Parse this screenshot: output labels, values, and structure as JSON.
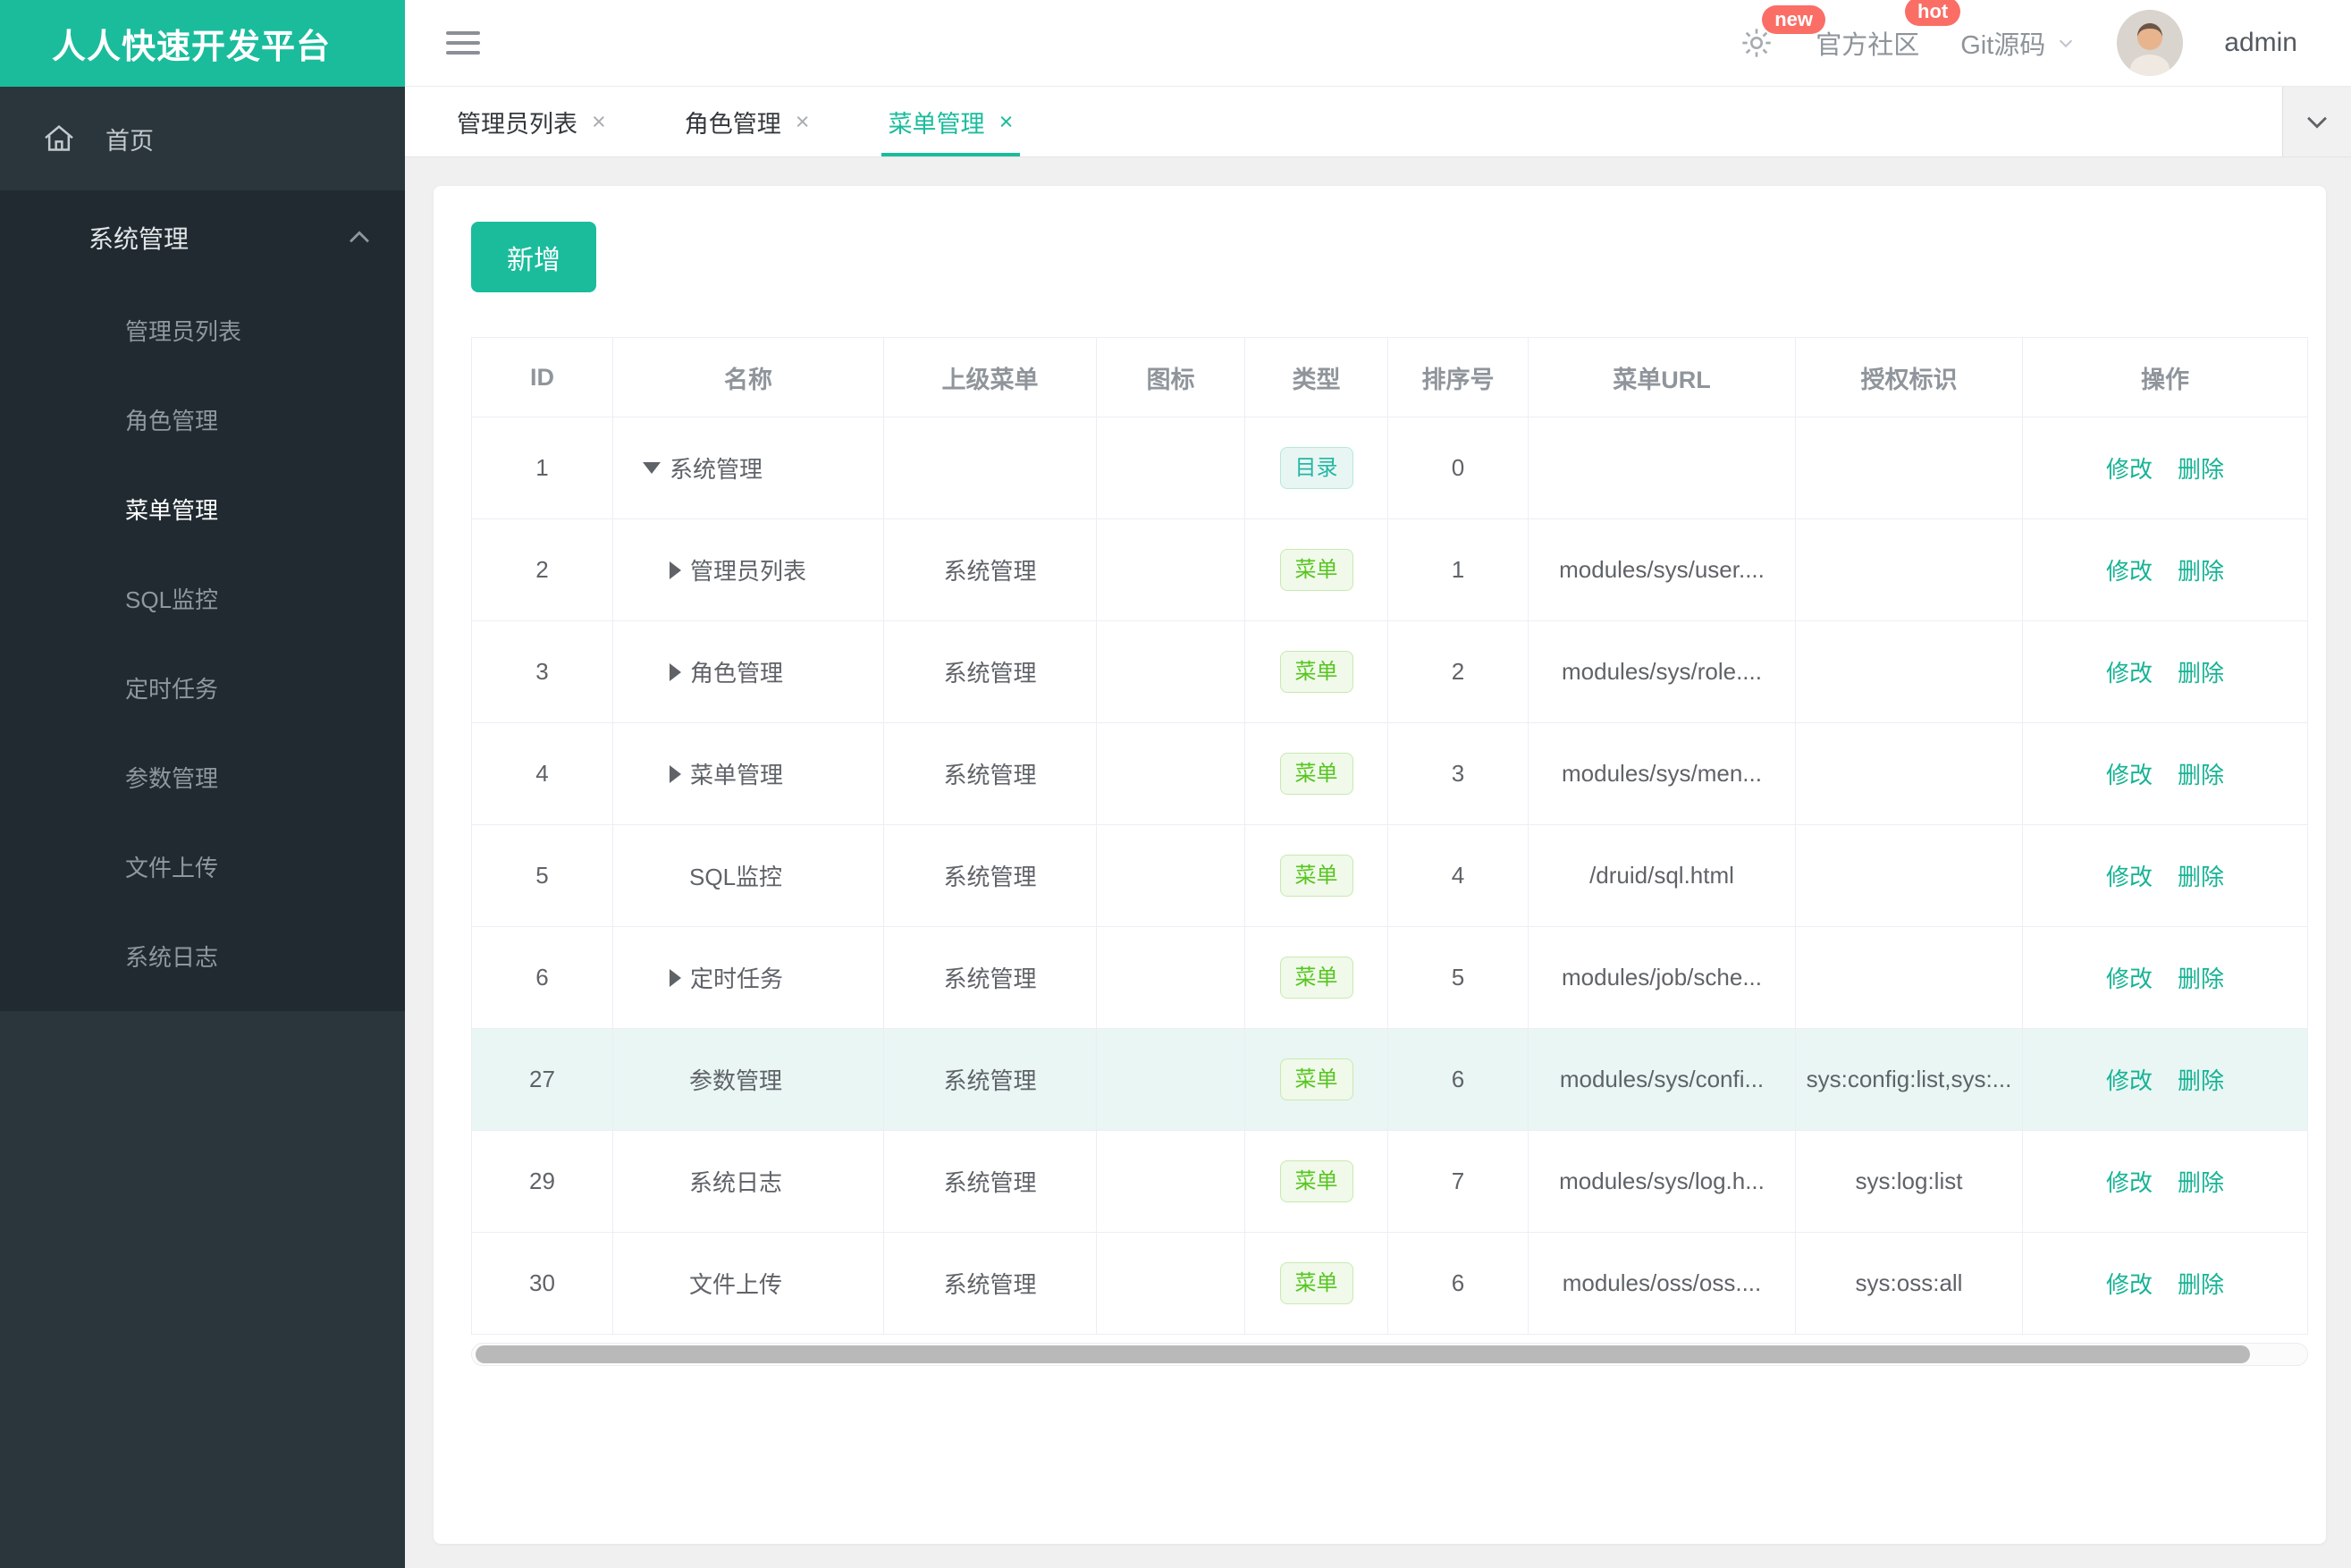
{
  "brand": {
    "title": "人人快速开发平台"
  },
  "header": {
    "gear_badge": "new",
    "community": {
      "label": "官方社区",
      "badge": "hot"
    },
    "git": {
      "label": "Git源码"
    },
    "username": "admin"
  },
  "sidebar": {
    "home": {
      "label": "首页"
    },
    "group": {
      "label": "系统管理",
      "items": [
        {
          "label": "管理员列表",
          "active": false
        },
        {
          "label": "角色管理",
          "active": false
        },
        {
          "label": "菜单管理",
          "active": true
        },
        {
          "label": "SQL监控",
          "active": false
        },
        {
          "label": "定时任务",
          "active": false
        },
        {
          "label": "参数管理",
          "active": false
        },
        {
          "label": "文件上传",
          "active": false
        },
        {
          "label": "系统日志",
          "active": false
        }
      ]
    }
  },
  "tabs": [
    {
      "label": "管理员列表",
      "active": false
    },
    {
      "label": "角色管理",
      "active": false
    },
    {
      "label": "菜单管理",
      "active": true
    }
  ],
  "toolbar": {
    "add_label": "新增"
  },
  "table": {
    "columns": [
      "ID",
      "名称",
      "上级菜单",
      "图标",
      "类型",
      "排序号",
      "菜单URL",
      "授权标识",
      "操作"
    ],
    "actions": {
      "edit": "修改",
      "delete": "删除"
    },
    "type_styles": {
      "目录": {
        "color": "#23b7a4",
        "bg": "#e8f6f3",
        "border": "#b7e6de"
      },
      "菜单": {
        "color": "#57c520",
        "bg": "#f0f9ea",
        "border": "#c9e9b0"
      }
    },
    "rows": [
      {
        "id": "1",
        "name": "系统管理",
        "arrow": "down",
        "indent": 0,
        "parent": "",
        "type": "目录",
        "sort": "0",
        "url": "",
        "perm": "",
        "highlighted": false
      },
      {
        "id": "2",
        "name": "管理员列表",
        "arrow": "right",
        "indent": 1,
        "parent": "系统管理",
        "type": "菜单",
        "sort": "1",
        "url": "modules/sys/user....",
        "perm": "",
        "highlighted": false
      },
      {
        "id": "3",
        "name": "角色管理",
        "arrow": "right",
        "indent": 1,
        "parent": "系统管理",
        "type": "菜单",
        "sort": "2",
        "url": "modules/sys/role....",
        "perm": "",
        "highlighted": false
      },
      {
        "id": "4",
        "name": "菜单管理",
        "arrow": "right",
        "indent": 1,
        "parent": "系统管理",
        "type": "菜单",
        "sort": "3",
        "url": "modules/sys/men...",
        "perm": "",
        "highlighted": false
      },
      {
        "id": "5",
        "name": "SQL监控",
        "arrow": null,
        "indent": 1,
        "parent": "系统管理",
        "type": "菜单",
        "sort": "4",
        "url": "/druid/sql.html",
        "perm": "",
        "highlighted": false
      },
      {
        "id": "6",
        "name": "定时任务",
        "arrow": "right",
        "indent": 1,
        "parent": "系统管理",
        "type": "菜单",
        "sort": "5",
        "url": "modules/job/sche...",
        "perm": "",
        "highlighted": false
      },
      {
        "id": "27",
        "name": "参数管理",
        "arrow": null,
        "indent": 1,
        "parent": "系统管理",
        "type": "菜单",
        "sort": "6",
        "url": "modules/sys/confi...",
        "perm": "sys:config:list,sys:...",
        "highlighted": true
      },
      {
        "id": "29",
        "name": "系统日志",
        "arrow": null,
        "indent": 1,
        "parent": "系统管理",
        "type": "菜单",
        "sort": "7",
        "url": "modules/sys/log.h...",
        "perm": "sys:log:list",
        "highlighted": false
      },
      {
        "id": "30",
        "name": "文件上传",
        "arrow": null,
        "indent": 1,
        "parent": "系统管理",
        "type": "菜单",
        "sort": "6",
        "url": "modules/oss/oss....",
        "perm": "sys:oss:all",
        "highlighted": false
      }
    ]
  },
  "colors": {
    "brand_teal": "#1abc9c",
    "badge_red": "#fa6e66",
    "link_teal": "#17b394",
    "highlight_row": "#e9f6f4"
  }
}
